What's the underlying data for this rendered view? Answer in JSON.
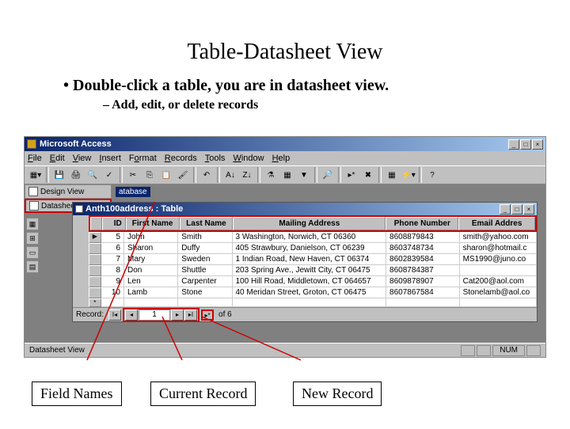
{
  "slide": {
    "title": "Table-Datasheet View",
    "bullet1": "Double-click a table, you are in datasheet view.",
    "bullet2": "Add, edit, or delete records"
  },
  "app": {
    "title": "Microsoft Access",
    "menus": [
      "File",
      "Edit",
      "View",
      "Insert",
      "Format",
      "Records",
      "Tools",
      "Window",
      "Help"
    ],
    "view_buttons": {
      "design": "Design View",
      "datasheet": "Datasheet View"
    },
    "db_hint": "atabase",
    "table_window_title": "Anth100address : Table",
    "columns": [
      "ID",
      "First Name",
      "Last Name",
      "Mailing Address",
      "Phone Number",
      "Email Addres"
    ],
    "rows": [
      {
        "sel": "▶",
        "id": "5",
        "fn": "John",
        "ln": "Smith",
        "ad": "3 Washington, Norwich, CT 06360",
        "ph": "8608879843",
        "em": "smith@yahoo.com"
      },
      {
        "sel": "",
        "id": "6",
        "fn": "Sharon",
        "ln": "Duffy",
        "ad": "405 Strawbury, Danielson, CT 06239",
        "ph": "8603748734",
        "em": "sharon@hotmail.c"
      },
      {
        "sel": "",
        "id": "7",
        "fn": "Mary",
        "ln": "Sweden",
        "ad": "1 Indian Road, New Haven, CT 06374",
        "ph": "8602839584",
        "em": "MS1990@juno.co"
      },
      {
        "sel": "",
        "id": "8",
        "fn": "Don",
        "ln": "Shuttle",
        "ad": "203 Spring Ave., Jewitt City, CT 06475",
        "ph": "8608784387",
        "em": ""
      },
      {
        "sel": "",
        "id": "9",
        "fn": "Len",
        "ln": "Carpenter",
        "ad": "100 Hill Road, Middletown, CT 064657",
        "ph": "8609878907",
        "em": "Cat200@aol.com"
      },
      {
        "sel": "",
        "id": "10",
        "fn": "Lamb",
        "ln": "Stone",
        "ad": "40 Meridan Street, Groton, CT 06475",
        "ph": "8607867584",
        "em": "Stonelamb@aol.co"
      },
      {
        "sel": "*",
        "id": "",
        "fn": "",
        "ln": "",
        "ad": "",
        "ph": "",
        "em": ""
      }
    ],
    "recnav": {
      "label": "Record:",
      "current": "1",
      "of_text": "of  6"
    },
    "status": {
      "left": "Datasheet View",
      "num": "NUM"
    }
  },
  "callouts": {
    "fieldnames": "Field Names",
    "current": "Current Record",
    "newrec": "New Record"
  }
}
